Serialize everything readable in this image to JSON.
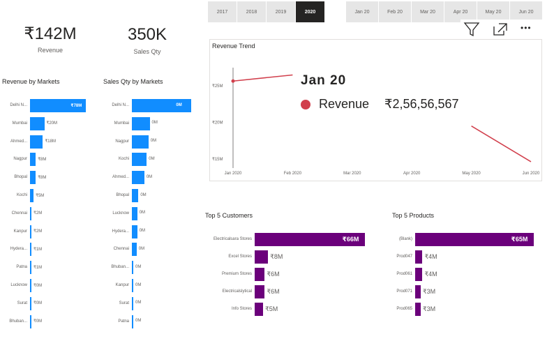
{
  "colors": {
    "blue": "#118DFF",
    "purple": "#6B007B",
    "red": "#D13F4C",
    "selected": "#252423",
    "slicer": "#E6E6E6"
  },
  "year_slicer": {
    "items": [
      {
        "label": "2017",
        "selected": false
      },
      {
        "label": "2018",
        "selected": false
      },
      {
        "label": "2019",
        "selected": false
      },
      {
        "label": "2020",
        "selected": true
      }
    ]
  },
  "month_slicer": {
    "items": [
      {
        "label": "Jan 20",
        "selected": false
      },
      {
        "label": "Feb 20",
        "selected": false
      },
      {
        "label": "Mar 20",
        "selected": false
      },
      {
        "label": "Apr 20",
        "selected": false
      },
      {
        "label": "May 20",
        "selected": false
      },
      {
        "label": "Jun 20",
        "selected": false
      }
    ]
  },
  "toolbar": {
    "icons": [
      "filter-icon",
      "focus-mode-icon",
      "more-options-icon"
    ],
    "more_label": "•••"
  },
  "kpis": {
    "revenue": {
      "value": "₹142M",
      "label": "Revenue"
    },
    "sales_qty": {
      "value": "350K",
      "label": "Sales Qty"
    }
  },
  "revenue_by_markets": {
    "title": "Revenue by Markets",
    "rows": [
      {
        "label": "Delhi N...",
        "value": 78,
        "text": "₹78M"
      },
      {
        "label": "Mumbai",
        "value": 20,
        "text": "₹20M"
      },
      {
        "label": "Ahmed...",
        "value": 18,
        "text": "₹18M"
      },
      {
        "label": "Nagpur",
        "value": 8,
        "text": "₹8M"
      },
      {
        "label": "Bhopal",
        "value": 8,
        "text": "₹8M"
      },
      {
        "label": "Kochi",
        "value": 5,
        "text": "₹5M"
      },
      {
        "label": "Chennai",
        "value": 2,
        "text": "₹2M"
      },
      {
        "label": "Kanpur",
        "value": 2,
        "text": "₹2M"
      },
      {
        "label": "Hydera...",
        "value": 1,
        "text": "₹1M"
      },
      {
        "label": "Patna",
        "value": 1,
        "text": "₹1M"
      },
      {
        "label": "Lucknow",
        "value": 0,
        "text": "₹0M"
      },
      {
        "label": "Surat",
        "value": 0,
        "text": "₹0M"
      },
      {
        "label": "Bhuban...",
        "value": 0,
        "text": "₹0M"
      }
    ]
  },
  "sales_qty_by_markets": {
    "title": "Sales Qty by Markets",
    "rows": [
      {
        "label": "Delhi N...",
        "value": 100,
        "text": "0M"
      },
      {
        "label": "Mumbai",
        "value": 30,
        "text": "0M"
      },
      {
        "label": "Nagpur",
        "value": 28,
        "text": "0M"
      },
      {
        "label": "Kochi",
        "value": 25,
        "text": "0M"
      },
      {
        "label": "Ahmed...",
        "value": 21,
        "text": "0M"
      },
      {
        "label": "Bhopal",
        "value": 11,
        "text": "0M"
      },
      {
        "label": "Lucknow",
        "value": 9,
        "text": "0M"
      },
      {
        "label": "Hydera...",
        "value": 9,
        "text": "0M"
      },
      {
        "label": "Chennai",
        "value": 8,
        "text": "0M"
      },
      {
        "label": "Bhuban...",
        "value": 2,
        "text": "0M"
      },
      {
        "label": "Kanpur",
        "value": 1,
        "text": "0M"
      },
      {
        "label": "Surat",
        "value": 0,
        "text": "0M"
      },
      {
        "label": "Patna",
        "value": 0,
        "text": "0M"
      }
    ]
  },
  "chart_data": [
    {
      "type": "line",
      "title": "Revenue Trend",
      "x": [
        "Jan 2020",
        "Feb 2020",
        "Mar 2020",
        "Apr 2020",
        "May 2020",
        "Jun 2020"
      ],
      "series": [
        {
          "name": "Revenue",
          "values": [
            25.66,
            26.5,
            null,
            null,
            19.5,
            14.6
          ]
        }
      ],
      "y_ticks": [
        "₹15M",
        "₹20M",
        "₹25M"
      ],
      "ylim": [
        14.5,
        27.5
      ],
      "tooltip": {
        "title": "Jan 20",
        "series": "Revenue",
        "value": "₹2,56,56,567"
      }
    }
  ],
  "top_customers": {
    "title": "Top 5 Customers",
    "rows": [
      {
        "label": "Electricalsara Stores",
        "value": 66,
        "text": "₹66M"
      },
      {
        "label": "Excel Stores",
        "value": 8,
        "text": "₹8M"
      },
      {
        "label": "Premium Stores",
        "value": 6,
        "text": "₹6M"
      },
      {
        "label": "Electricalslytical",
        "value": 6,
        "text": "₹6M"
      },
      {
        "label": "Info Stores",
        "value": 5,
        "text": "₹5M"
      }
    ]
  },
  "top_products": {
    "title": "Top 5 Products",
    "rows": [
      {
        "label": "(Blank)",
        "value": 65,
        "text": "₹65M"
      },
      {
        "label": "Prod047",
        "value": 4,
        "text": "₹4M"
      },
      {
        "label": "Prod061",
        "value": 4,
        "text": "₹4M"
      },
      {
        "label": "Prod071",
        "value": 3,
        "text": "₹3M"
      },
      {
        "label": "Prod065",
        "value": 3,
        "text": "₹3M"
      }
    ]
  }
}
